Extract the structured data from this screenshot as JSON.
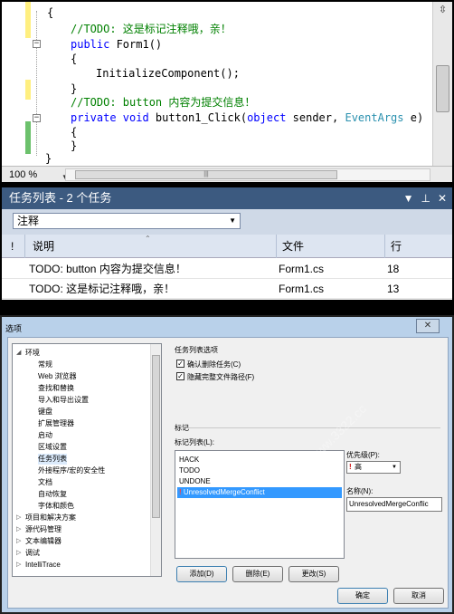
{
  "editor": {
    "lines": [
      {
        "kind": "brace",
        "text": "{"
      },
      {
        "kind": "comment",
        "text": "//TODO: 这是标记注释哦，亲！"
      },
      {
        "kind": "ctor",
        "kw": "public",
        "name": " Form1()"
      },
      {
        "kind": "plain",
        "text": "{"
      },
      {
        "kind": "plain",
        "text": "InitializeComponent();"
      },
      {
        "kind": "plain",
        "text": "}"
      },
      {
        "kind": "comment",
        "text": "//TODO: button 内容为提交信息！"
      },
      {
        "kind": "method",
        "kw": "private void",
        "name": " button1_Click(",
        "kw2": "object",
        "mid": " sender, ",
        "type": "EventArgs",
        "end": " e)"
      },
      {
        "kind": "plain",
        "text": "{"
      },
      {
        "kind": "plain",
        "text": "}"
      },
      {
        "kind": "plain",
        "text": "}"
      }
    ],
    "zoom": "100 %"
  },
  "task_list": {
    "title": "任务列表 - 2 个任务",
    "pin_icon": "pin-icon",
    "filter_value": "注释",
    "columns": {
      "priority": "!",
      "description": "说明",
      "file": "文件",
      "line": "行"
    },
    "rows": [
      {
        "description": "TODO: button 内容为提交信息！",
        "file": "Form1.cs",
        "line": "18"
      },
      {
        "description": "TODO: 这是标记注释哦，亲！",
        "file": "Form1.cs",
        "line": "13"
      }
    ]
  },
  "dialog": {
    "title": "选项",
    "tree": [
      {
        "label": "环境",
        "level": 0,
        "expanded": true
      },
      {
        "label": "常规",
        "level": 1
      },
      {
        "label": "Web 浏览器",
        "level": 1
      },
      {
        "label": "查找和替换",
        "level": 1
      },
      {
        "label": "导入和导出设置",
        "level": 1
      },
      {
        "label": "键盘",
        "level": 1
      },
      {
        "label": "扩展管理器",
        "level": 1
      },
      {
        "label": "启动",
        "level": 1
      },
      {
        "label": "区域设置",
        "level": 1
      },
      {
        "label": "任务列表",
        "level": 1,
        "selected": true
      },
      {
        "label": "外接程序/宏的安全性",
        "level": 1
      },
      {
        "label": "文档",
        "level": 1
      },
      {
        "label": "自动恢复",
        "level": 1
      },
      {
        "label": "字体和颜色",
        "level": 1
      },
      {
        "label": "项目和解决方案",
        "level": 0
      },
      {
        "label": "源代码管理",
        "level": 0
      },
      {
        "label": "文本编辑器",
        "level": 0
      },
      {
        "label": "调试",
        "level": 0
      },
      {
        "label": "IntelliTrace",
        "level": 0
      }
    ],
    "options_group": "任务列表选项",
    "confirm_delete": "确认删除任务(C)",
    "hide_full_path": "隐藏完整文件路径(F)",
    "tokens_group": "标记",
    "token_list_label": "标记列表(L):",
    "tokens": [
      {
        "label": "HACK"
      },
      {
        "label": "TODO"
      },
      {
        "label": "UNDONE"
      },
      {
        "label": "UnresolvedMergeConflict",
        "selected": true
      }
    ],
    "priority_label": "优先级(P):",
    "priority_value": "高",
    "name_label": "名称(N):",
    "name_value": "UnresolvedMergeConflic",
    "add_button": "添加(D)",
    "delete_button": "删除(E)",
    "change_button": "更改(S)",
    "ok_button": "确定",
    "cancel_button": "取消"
  }
}
